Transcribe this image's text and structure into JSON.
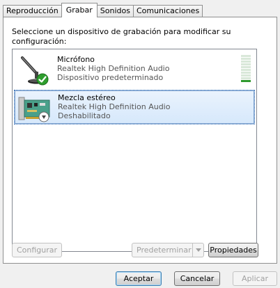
{
  "tabs": [
    {
      "label": "Reproducción",
      "active": false
    },
    {
      "label": "Grabar",
      "active": true
    },
    {
      "label": "Sonidos",
      "active": false
    },
    {
      "label": "Comunicaciones",
      "active": false
    }
  ],
  "instruction": "Seleccione un dispositivo de grabación para modificar su configuración:",
  "devices": [
    {
      "name": "Micrófono",
      "driver": "Realtek High Definition Audio",
      "status": "Dispositivo predeterminado",
      "icon": "microphone-icon",
      "badge": "default-check-icon",
      "level": 0.1
    },
    {
      "name": "Mezcla estéreo",
      "driver": "Realtek High Definition Audio",
      "status": "Deshabilitado",
      "icon": "sound-card-icon",
      "badge": "disabled-arrow-icon",
      "selected": true
    }
  ],
  "panel_buttons": {
    "configure": "Configurar",
    "set_default": "Predeterminar",
    "properties": "Propiedades"
  },
  "dialog_buttons": {
    "ok": "Aceptar",
    "cancel": "Cancelar",
    "apply": "Aplicar"
  },
  "colors": {
    "selection": "#d6e8fb",
    "check_green": "#2e9e2e",
    "meter_green": "#2f9a2f"
  }
}
